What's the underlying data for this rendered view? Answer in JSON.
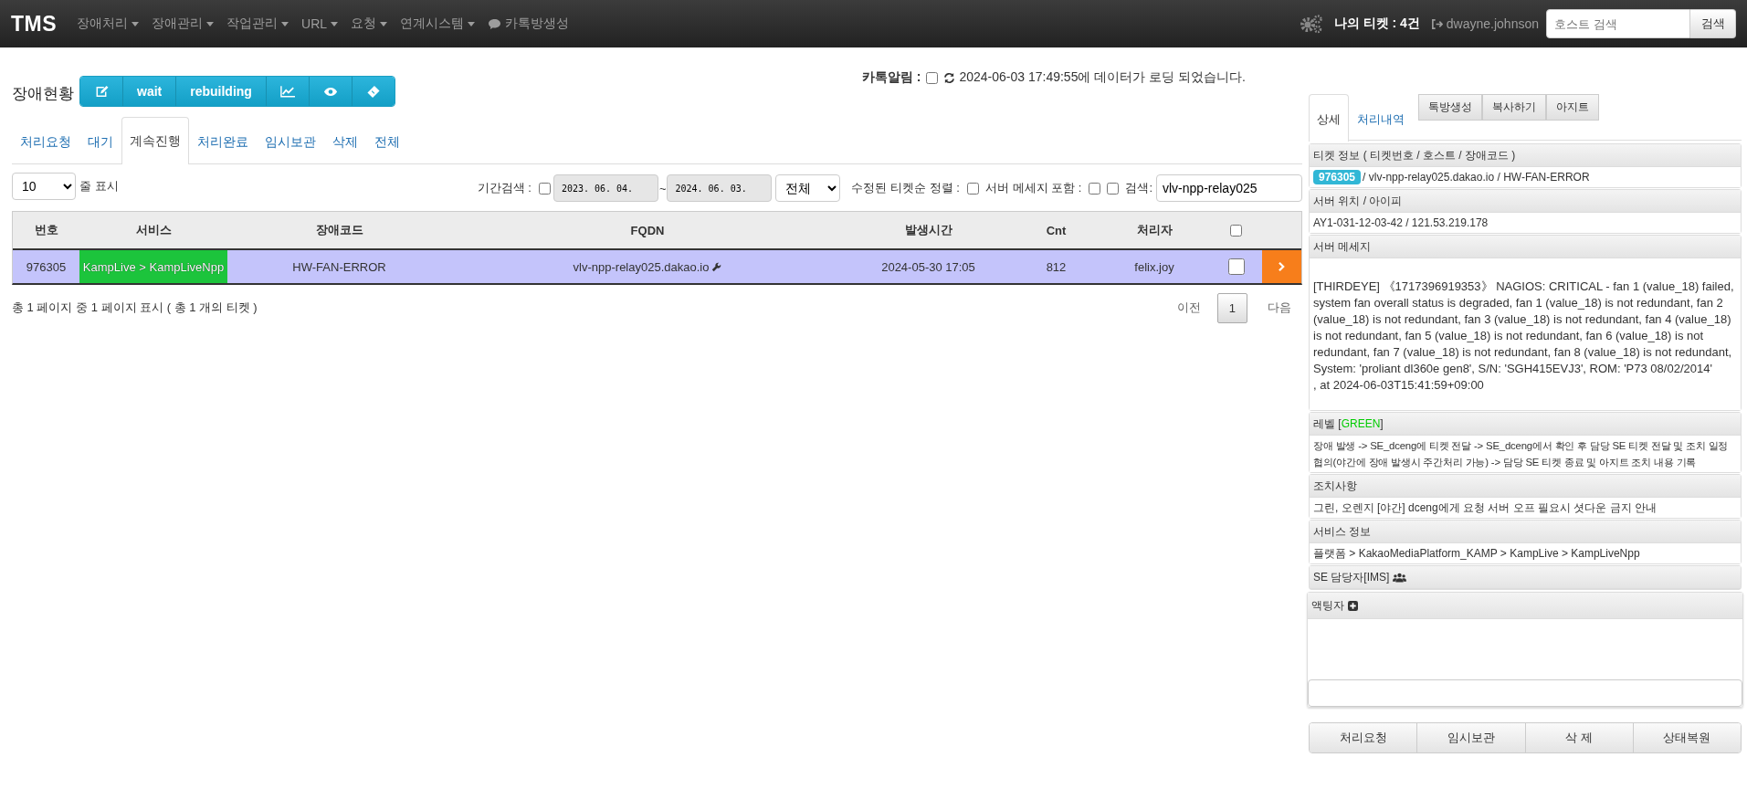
{
  "navbar": {
    "brand": "TMS",
    "menus": [
      {
        "label": "장애처리",
        "kind": "dropdown"
      },
      {
        "label": "장애관리",
        "kind": "dropdown"
      },
      {
        "label": "작업관리",
        "kind": "dropdown"
      },
      {
        "label": "URL",
        "kind": "dropdown"
      },
      {
        "label": "요청",
        "kind": "dropdown"
      },
      {
        "label": "연계시스템",
        "kind": "dropdown"
      },
      {
        "label": "카톡방생성",
        "kind": "chat"
      }
    ],
    "my_tickets": "나의 티켓 : 4건",
    "user": "dwayne.johnson",
    "host_search": {
      "placeholder": "호스트 검색"
    },
    "search_button": "검색"
  },
  "page_title": "장애현황",
  "toolbar": [
    {
      "kind": "edit"
    },
    {
      "kind": "text",
      "label": "wait"
    },
    {
      "kind": "text",
      "label": "rebuilding"
    },
    {
      "kind": "chart"
    },
    {
      "kind": "eye"
    },
    {
      "kind": "tag"
    }
  ],
  "notification": {
    "label": "카톡알림 :",
    "checked": false,
    "message": "2024-06-03 17:49:55에 데이터가 로딩 되었습니다."
  },
  "tabs": [
    {
      "label": "처리요청",
      "selected": false
    },
    {
      "label": "대기",
      "selected": false
    },
    {
      "label": "계속진행",
      "selected": true
    },
    {
      "label": "처리완료",
      "selected": false
    },
    {
      "label": "임시보관",
      "selected": false
    },
    {
      "label": "삭제",
      "selected": false
    },
    {
      "label": "전체",
      "selected": false
    }
  ],
  "filters": {
    "page_size": "10",
    "page_size_label": "줄 표시",
    "period_label": "기간검색 :",
    "period_checked": false,
    "date_from": "2023. 06. 04.",
    "tilde": "~",
    "date_to": "2024. 06. 03.",
    "range": "전체",
    "sort_label": "수정된 티켓순 정렬 :",
    "sort_checked": false,
    "include_label": "서버 메세지 포함 :",
    "include_checked": false,
    "search_checked": false,
    "search_label": "검색:",
    "search_value": "vlv-npp-relay025"
  },
  "table": {
    "columns": [
      "번호",
      "서비스",
      "장애코드",
      "FQDN",
      "발생시간",
      "Cnt",
      "처리자"
    ],
    "select_all_checked": false,
    "rows": [
      {
        "selected": true,
        "checked": false,
        "cells": [
          "976305",
          "KampLive > KampLiveNpp",
          "HW-FAN-ERROR",
          "vlv-npp-relay025.dakao.io",
          "2024-05-30 17:05",
          "812",
          "felix.joy"
        ]
      }
    ]
  },
  "table_info": "총 1 페이지 중 1 페이지 표시 ( 총 1 개의 티켓 )",
  "pagination": [
    {
      "label": "이전",
      "selected": false
    },
    {
      "label": "1",
      "selected": true
    },
    {
      "label": "다음",
      "selected": false
    }
  ],
  "detail": {
    "tabs": [
      {
        "label": "상세",
        "selected": true
      },
      {
        "label": "처리내역",
        "selected": false
      }
    ],
    "buttons": [
      "톡방생성",
      "복사하기",
      "아지트"
    ],
    "ticket_heading": "티켓 정보 ( 티켓번호 / 호스트 / 장애코드 )",
    "ticket_id": "976305",
    "ticket_rest": "/ vlv-npp-relay025.dakao.io / HW-FAN-ERROR",
    "location_heading": "서버 위치 / 아이피",
    "location": "AY1-031-12-03-42 / 121.53.219.178",
    "message_heading": "서버 메세지",
    "message": "[THIRDEYE] 《1717396919353》 NAGIOS: CRITICAL - fan 1 (value_18) failed, system fan overall status is degraded, fan 1 (value_18) is not redundant, fan 2 (value_18) is not redundant, fan 3 (value_18) is not redundant, fan 4 (value_18) is not redundant, fan 5 (value_18) is not redundant, fan 6 (value_18) is not redundant, fan 7 (value_18) is not redundant, fan 8 (value_18) is not redundant, System: 'proliant dl360e gen8', S/N: 'SGH415EVJ3', ROM: 'P73 08/02/2014'\n, at 2024-06-03T15:41:59+09:00",
    "level": {
      "prefix": "레벨 [",
      "value": "GREEN",
      "suffix": "]",
      "color": "#00cc00"
    },
    "level_text": "장애 발생 -> SE_dceng에 티켓 전달 -> SE_dceng에서 확인 후 담당 SE 티켓 전달 및 조치 일정 협의(야간에 장애 발생시 주간처리 가능) -> 담당 SE 티켓 종료 및 아지트 조치 내용 기록",
    "action_heading": "조치사항",
    "action": "그린, 오렌지 [야간] dceng에게 요청 서버 오프 필요시 셧다운 금지 안내",
    "service_heading": "서비스 정보",
    "service": "플랫폼 > KakaoMediaPlatform_KAMP > KampLive > KampLiveNpp",
    "owner_heading": "SE 담당자[IMS]",
    "actor_heading": "액팅자",
    "bottom_buttons": [
      "처리요청",
      "임시보관",
      "삭 제",
      "상태복원"
    ]
  }
}
